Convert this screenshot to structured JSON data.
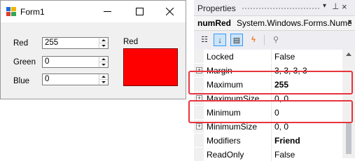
{
  "form": {
    "title": "Form1",
    "fields": [
      {
        "label": "Red",
        "value": "255"
      },
      {
        "label": "Green",
        "value": "0"
      },
      {
        "label": "Blue",
        "value": "0"
      }
    ],
    "color_label": "Red",
    "color_swatch": "#ff0000"
  },
  "properties": {
    "title": "Properties",
    "object_name": "numRed",
    "object_type": "System.Windows.Forms.Nume",
    "rows": [
      {
        "name": "Locked",
        "value": "False"
      },
      {
        "name": "Margin",
        "value": "3, 3, 3, 3"
      },
      {
        "name": "Maximum",
        "value": "255"
      },
      {
        "name": "MaximumSize",
        "value": "0, 0"
      },
      {
        "name": "Minimum",
        "value": "0"
      },
      {
        "name": "MinimumSize",
        "value": "0, 0"
      },
      {
        "name": "Modifiers",
        "value": "Friend"
      },
      {
        "name": "ReadOnly",
        "value": "False"
      }
    ]
  },
  "colors": {
    "highlight": "#e8343e",
    "selected_tool": "#cce4f7"
  }
}
